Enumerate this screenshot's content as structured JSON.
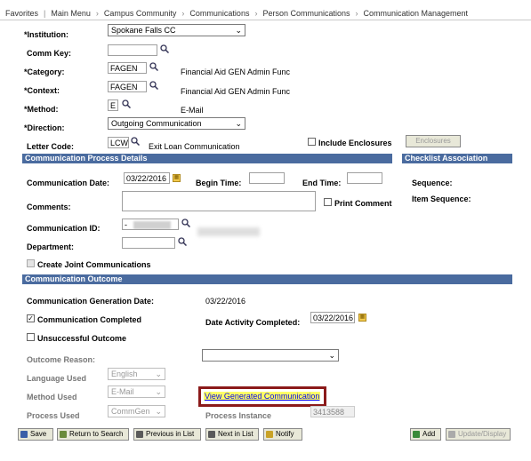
{
  "breadcrumb": [
    "Favorites",
    "Main Menu",
    "Campus Community",
    "Communications",
    "Person Communications",
    "Communication Management"
  ],
  "fields": {
    "institution": {
      "label": "*Institution:",
      "value": "Spokane Falls CC"
    },
    "comm_key": {
      "label": "Comm Key:",
      "value": ""
    },
    "category": {
      "label": "*Category:",
      "value": "FAGEN",
      "desc": "Financial Aid GEN Admin Func"
    },
    "context": {
      "label": "*Context:",
      "value": "FAGEN",
      "desc": "Financial Aid GEN Admin Func"
    },
    "method": {
      "label": "*Method:",
      "value": "E",
      "desc": "E-Mail"
    },
    "direction": {
      "label": "*Direction:",
      "value": "Outgoing Communication"
    },
    "letter_code": {
      "label": "Letter Code:",
      "value": "LCW",
      "desc": "Exit Loan Communication"
    },
    "include_enclosures": {
      "label": "Include Enclosures",
      "checked": false
    },
    "enclosures_button": "Enclosures"
  },
  "process_details": {
    "header": "Communication Process Details",
    "comm_date_label": "Communication Date:",
    "comm_date": "03/22/2016",
    "begin_time_label": "Begin Time:",
    "end_time_label": "End Time:",
    "comments_label": "Comments:",
    "print_comment_label": "Print Comment",
    "comm_id_label": "Communication ID:",
    "comm_id_value": "-",
    "department_label": "Department:",
    "joint_label": "Create Joint Communications"
  },
  "checklist": {
    "header": "Checklist Association",
    "sequence_label": "Sequence:",
    "item_sequence_label": "Item Sequence:"
  },
  "outcome": {
    "header": "Communication Outcome",
    "gen_date_label": "Communication Generation Date:",
    "gen_date": "03/22/2016",
    "completed_label": "Communication Completed",
    "completed": true,
    "date_completed_label": "Date Activity Completed:",
    "date_completed": "03/22/2016",
    "unsuccessful_label": "Unsuccessful Outcome",
    "outcome_reason_label": "Outcome Reason:",
    "language_label": "Language Used",
    "language_value": "English",
    "method_used_label": "Method Used",
    "method_used_value": "E-Mail",
    "process_used_label": "Process Used",
    "process_used_value": "CommGen",
    "view_link": "View Generated Communication",
    "process_instance_label": "Process Instance",
    "process_instance_value": "3413588"
  },
  "toolbar": {
    "save": "Save",
    "return": "Return to Search",
    "prev": "Previous in List",
    "next": "Next in List",
    "notify": "Notify",
    "add": "Add",
    "update": "Update/Display"
  },
  "colors": {
    "section_bar": "#4a6b9f",
    "highlight_box": "#8b1a1a",
    "link_highlight": "#ffff66"
  }
}
